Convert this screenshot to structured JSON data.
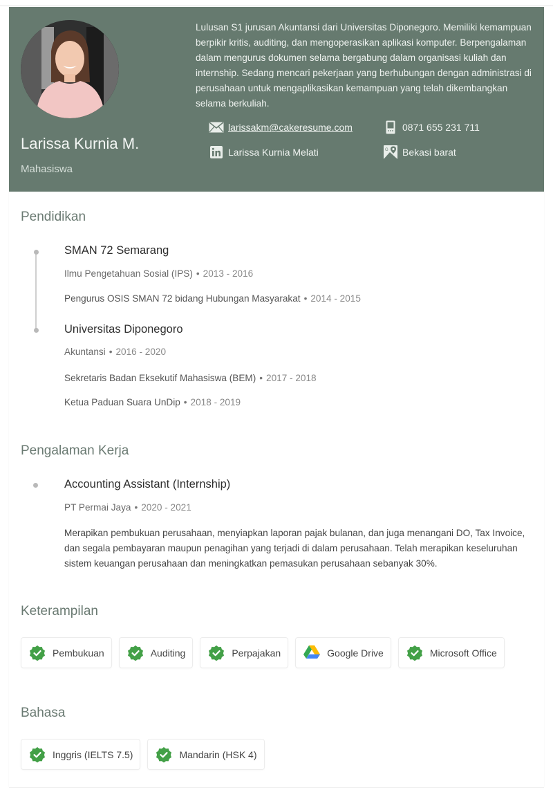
{
  "profile": {
    "name": "Larissa Kurnia M.",
    "title": "Mahasiswa",
    "summary": "Lulusan S1 jurusan Akuntansi dari Universitas Diponegoro. Memiliki kemampuan berpikir kritis, auditing, dan mengoperasikan aplikasi komputer. Berpengalaman dalam mengurus dokumen selama bergabung dalam organisasi kuliah dan internship. Sedang mencari pekerjaan yang berhubungan dengan administrasi di perusahaan untuk mengaplikasikan kemampuan yang telah dikembangkan selama berkuliah.",
    "contacts": {
      "email": {
        "icon": "mail-icon",
        "value": "larissakm@cakeresume.com"
      },
      "phone": {
        "icon": "phone-icon",
        "value": "0871 655 231 711"
      },
      "linkedin": {
        "icon": "linkedin-icon",
        "value": "Larissa Kurnia Melati"
      },
      "location": {
        "icon": "map-pin-icon",
        "value": "Bekasi barat"
      }
    },
    "header_color": "#667a6f"
  },
  "education": {
    "heading": "Pendidikan",
    "items": [
      {
        "school": "SMAN 72 Semarang",
        "field": "Ilmu Pengetahuan Sosial (IPS)",
        "years": "2013 - 2016",
        "activities": [
          {
            "name": "Pengurus OSIS SMAN 72 bidang Hubungan Masyarakat",
            "years": "2014 - 2015"
          }
        ]
      },
      {
        "school": "Universitas Diponegoro",
        "field": "Akuntansi",
        "years": "2016 - 2020",
        "activities": [
          {
            "name": "Sekretaris Badan Eksekutif Mahasiswa (BEM)",
            "years": "2017 - 2018"
          },
          {
            "name": "Ketua Paduan Suara UnDip",
            "years": "2018 - 2019"
          }
        ]
      }
    ]
  },
  "experience": {
    "heading": "Pengalaman Kerja",
    "items": [
      {
        "role": "Accounting Assistant (Internship)",
        "company": "PT Permai Jaya",
        "years": "2020 - 2021",
        "description": "Merapikan pembukuan perusahaan, menyiapkan laporan pajak bulanan, dan juga menangani DO, Tax Invoice, dan segala pembayaran maupun penagihan yang terjadi di dalam perusahaan. Telah merapikan keseluruhan sistem keuangan perusahaan dan meningkatkan pemasukan perusahaan sebanyak 30%."
      }
    ]
  },
  "skills": {
    "heading": "Keterampilan",
    "items": [
      {
        "label": "Pembukuan",
        "icon": "verified-badge-icon"
      },
      {
        "label": "Auditing",
        "icon": "verified-badge-icon"
      },
      {
        "label": "Perpajakan",
        "icon": "verified-badge-icon"
      },
      {
        "label": "Google Drive",
        "icon": "google-drive-icon"
      },
      {
        "label": "Microsoft Office",
        "icon": "verified-badge-icon"
      }
    ]
  },
  "languages": {
    "heading": "Bahasa",
    "items": [
      {
        "label": "Inggris (IELTS 7.5)",
        "icon": "verified-badge-icon"
      },
      {
        "label": "Mandarin (HSK 4)",
        "icon": "verified-badge-icon"
      }
    ]
  },
  "colors": {
    "header_bg": "#667a6f",
    "badge_green": "#43a047"
  },
  "separator": "•"
}
